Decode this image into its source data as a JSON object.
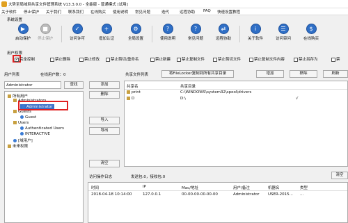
{
  "window": {
    "title": "大势至局域网共享文件管理系统 V13.3.0.0 - 全能版 - 普通模式 [试用]"
  },
  "menu": [
    "关于软件",
    "停止保护",
    "关于我们",
    "联系我们",
    "在线购买",
    "使用说明",
    "常见问题",
    "迭代",
    "远程协助",
    "FAQ",
    "快速设置教程"
  ],
  "system_settings_label": "系统设置",
  "toolbar": [
    {
      "label": "启动保护",
      "icon": "start-icon",
      "enabled": true
    },
    {
      "label": "停止保护",
      "icon": "stop-icon",
      "enabled": false
    },
    {
      "label": "访问许可",
      "icon": "permission-icon",
      "enabled": true
    },
    {
      "label": "增加认证",
      "icon": "auth-icon",
      "enabled": true
    },
    {
      "label": "全局设置",
      "icon": "settings-icon",
      "enabled": true
    },
    {
      "label": "使用说明",
      "icon": "help-icon",
      "enabled": true
    },
    {
      "label": "常见问题",
      "icon": "faq-icon",
      "enabled": true
    },
    {
      "label": "远程协助",
      "icon": "remote-icon",
      "enabled": true
    },
    {
      "label": "关于软件",
      "icon": "info-icon",
      "enabled": true
    },
    {
      "label": "访问审问",
      "icon": "audit-icon",
      "enabled": true
    },
    {
      "label": "在线购买",
      "icon": "cart-icon",
      "enabled": true
    }
  ],
  "user_perm_label": "用户权限",
  "permissions": [
    {
      "label": "完全控制",
      "checked": true
    },
    {
      "label": "禁止删除",
      "checked": false
    },
    {
      "label": "禁止修改",
      "checked": false
    },
    {
      "label": "禁止剪切/重命名",
      "checked": false
    },
    {
      "label": "禁止新建",
      "checked": false
    },
    {
      "label": "禁止复制文件",
      "checked": false
    },
    {
      "label": "禁止剪切文件",
      "checked": false
    },
    {
      "label": "禁止复制文件内容",
      "checked": false
    },
    {
      "label": "禁止另存为",
      "checked": false
    },
    {
      "label": "禁",
      "checked": false
    }
  ],
  "users": {
    "list_label": "用户列表",
    "online_count": "在线用户数：0",
    "search_value": "Administrator",
    "search_button": "查找",
    "tree": [
      {
        "label": "所有用户",
        "level": 0,
        "icon": "folder"
      },
      {
        "label": "Administrators",
        "level": 1,
        "icon": "folder"
      },
      {
        "label": "Administrator",
        "level": 2,
        "icon": "user",
        "selected": true
      },
      {
        "label": "Guests",
        "level": 1,
        "icon": "folder"
      },
      {
        "label": "Guest",
        "level": 2,
        "icon": "user"
      },
      {
        "label": "Users",
        "level": 1,
        "icon": "folder"
      },
      {
        "label": "Authenticated Users",
        "level": 2,
        "icon": "user"
      },
      {
        "label": "INTERACTIVE",
        "level": 2,
        "icon": "user"
      },
      {
        "label": "[域用户]",
        "level": 1,
        "icon": "user"
      },
      {
        "label": "未来权限",
        "level": 0,
        "icon": "folder"
      }
    ]
  },
  "mid_buttons": {
    "add": "添加",
    "delete": "删除",
    "import": "导入",
    "export": "导出",
    "clear": "清空"
  },
  "shares": {
    "label": "共享文件列表",
    "tab": "将FileLocker复制到所有共享目录",
    "add": "增加",
    "remove": "移除",
    "refresh": "刷新",
    "columns": [
      "共享名",
      "共享目录"
    ],
    "rows": [
      {
        "name": "print",
        "path": "C:\\WINDOWS\\system32\\spool\\drivers",
        "check": ""
      },
      {
        "name": "D",
        "path": "D:\\",
        "check": "√"
      }
    ]
  },
  "log": {
    "label": "访问操作日志",
    "stats": "发送包:0，接收包:0",
    "clear": "清空",
    "columns": [
      "时间",
      "IP",
      "Mac/地址",
      "用户/备注",
      "机器名",
      "类型"
    ],
    "rows": [
      {
        "time": "2018-04-18 10:14:00",
        "ip": "127.0.0.1",
        "mac": "00-00-00-00-00-00",
        "user": "Administrator",
        "host": "USER-2015...",
        "type": "..."
      }
    ]
  }
}
